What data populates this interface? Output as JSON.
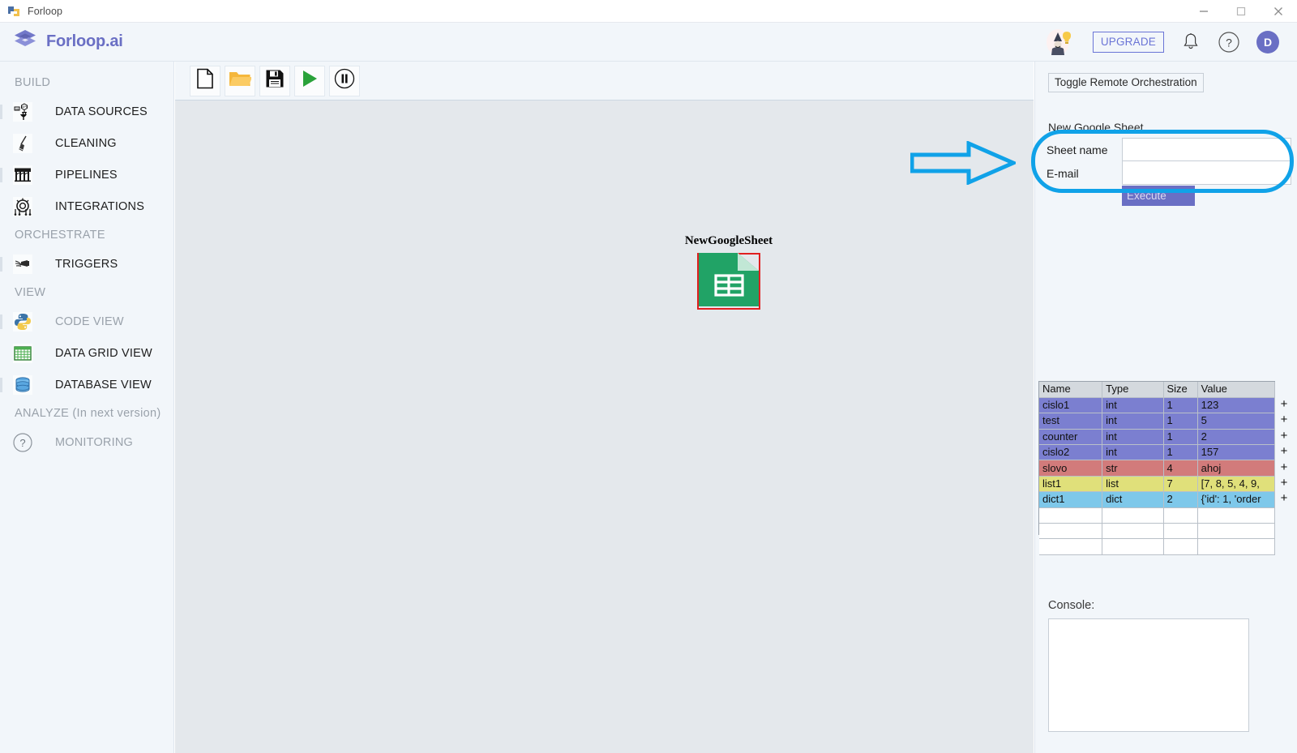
{
  "window": {
    "app_icon": "forloop-app-icon",
    "title": "Forloop",
    "controls": [
      {
        "name": "minimize-button",
        "glyph": "minimize-icon"
      },
      {
        "name": "maximize-button",
        "glyph": "maximize-icon"
      },
      {
        "name": "close-button",
        "glyph": "close-icon"
      }
    ]
  },
  "header": {
    "logo_icon": "forloop-logo-icon",
    "brand": "Forloop.ai",
    "wizard_icon": "wizard-hint-icon",
    "upgrade_label": "UPGRADE",
    "bell_icon": "notification-bell-icon",
    "help_icon": "help-question-icon",
    "avatar_initial": "D",
    "accent_color": "#6a6fc4"
  },
  "sidebar": {
    "groups": [
      {
        "label": "BUILD",
        "items": [
          {
            "label": "DATA SOURCES",
            "icon": "data-sources-icon",
            "dim": false
          },
          {
            "label": "CLEANING",
            "icon": "cleaning-broom-icon",
            "dim": false
          },
          {
            "label": "PIPELINES",
            "icon": "pipelines-aqueduct-icon",
            "dim": false
          },
          {
            "label": "INTEGRATIONS",
            "icon": "integrations-icon",
            "dim": false
          }
        ]
      },
      {
        "label": "ORCHESTRATE",
        "items": [
          {
            "label": "TRIGGERS",
            "icon": "triggers-icon",
            "dim": false
          }
        ]
      },
      {
        "label": "VIEW",
        "items": [
          {
            "label": "CODE VIEW",
            "icon": "python-icon",
            "dim": true
          },
          {
            "label": "DATA GRID VIEW",
            "icon": "data-grid-icon",
            "dim": false
          },
          {
            "label": "DATABASE VIEW",
            "icon": "database-icon",
            "dim": false
          }
        ]
      },
      {
        "label": "ANALYZE (In next version)",
        "items": [
          {
            "label": "MONITORING",
            "icon": "monitoring-question-icon",
            "dim": true
          }
        ]
      }
    ]
  },
  "toolbar": {
    "buttons": [
      {
        "name": "new-file-button",
        "icon": "new-file-icon"
      },
      {
        "name": "open-folder-button",
        "icon": "open-folder-icon"
      },
      {
        "name": "save-button",
        "icon": "save-floppy-icon"
      },
      {
        "name": "run-button",
        "icon": "play-triangle-icon"
      },
      {
        "name": "pause-button",
        "icon": "pause-circle-icon"
      }
    ]
  },
  "canvas": {
    "node": {
      "label": "NewGoogleSheet",
      "icon": "google-sheets-icon",
      "selection_color": "#e02020"
    },
    "annotations": {
      "arrow_color": "#10a2e8",
      "highlight_color": "#10a2e8"
    }
  },
  "right_panel": {
    "toggle_remote_label": "Toggle Remote Orchestration",
    "form": {
      "title": "New Google Sheet",
      "fields": [
        {
          "label": "Sheet name",
          "value": "",
          "placeholder": ""
        },
        {
          "label": "E-mail",
          "value": "",
          "placeholder": ""
        }
      ],
      "execute_label": "Execute",
      "execute_color": "#6a6fc4"
    },
    "variables": {
      "columns": [
        "Name",
        "Type",
        "Size",
        "Value"
      ],
      "rows": [
        {
          "name": "cislo1",
          "type": "int",
          "size": "1",
          "value": "123",
          "color": "#7b7fd0"
        },
        {
          "name": "test",
          "type": "int",
          "size": "1",
          "value": "5",
          "color": "#7b7fd0"
        },
        {
          "name": "counter",
          "type": "int",
          "size": "1",
          "value": "2",
          "color": "#7b7fd0"
        },
        {
          "name": "cislo2",
          "type": "int",
          "size": "1",
          "value": "157",
          "color": "#7b7fd0"
        },
        {
          "name": "slovo",
          "type": "str",
          "size": "4",
          "value": "ahoj",
          "color": "#d27b7b"
        },
        {
          "name": "list1",
          "type": "list",
          "size": "7",
          "value": "[7, 8, 5, 4, 9,",
          "color": "#e0e07a"
        },
        {
          "name": "dict1",
          "type": "dict",
          "size": "2",
          "value": "{'id': 1, 'order",
          "color": "#7ec8ea"
        },
        {
          "name": "",
          "type": "",
          "size": "",
          "value": "",
          "color": "#ffffff"
        },
        {
          "name": "",
          "type": "",
          "size": "",
          "value": "",
          "color": "#ffffff"
        },
        {
          "name": "",
          "type": "",
          "size": "",
          "value": "",
          "color": "#ffffff"
        }
      ],
      "add_button_glyph": "+"
    },
    "console": {
      "label": "Console:",
      "text": ""
    }
  }
}
